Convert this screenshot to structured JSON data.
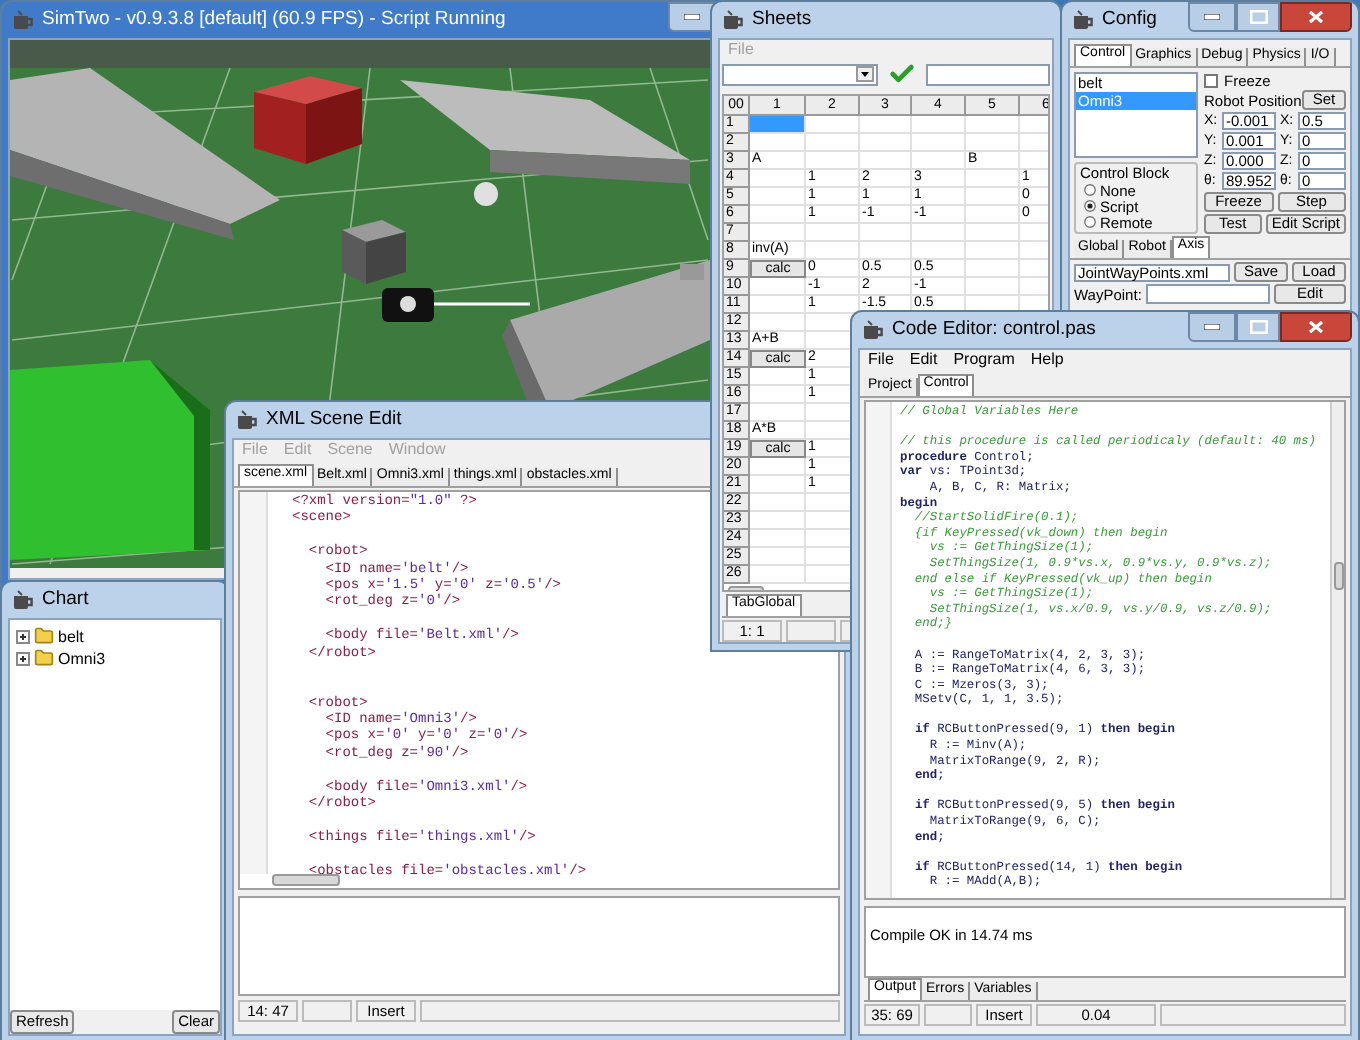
{
  "main_window": {
    "title": "SimTwo - v0.9.3.8 [default] (60.9 FPS) - Script Running"
  },
  "chart_window": {
    "title": "Chart",
    "tree": [
      {
        "label": "belt",
        "expanded": false
      },
      {
        "label": "Omni3",
        "expanded": false
      }
    ],
    "buttons": [
      "Refresh",
      "Clear"
    ]
  },
  "xml_editor": {
    "title": "XML Scene Edit",
    "menu": [
      {
        "label": "File",
        "disabled": true
      },
      {
        "label": "Edit",
        "disabled": true
      },
      {
        "label": "Scene",
        "disabled": true
      },
      {
        "label": "Window",
        "disabled": true
      }
    ],
    "tabs": [
      {
        "label": "scene.xml",
        "selected": true
      },
      {
        "label": "Belt.xml",
        "selected": false
      },
      {
        "label": "Omni3.xml",
        "selected": false
      },
      {
        "label": "things.xml",
        "selected": false
      },
      {
        "label": "obstacles.xml",
        "selected": false
      }
    ],
    "lines": [
      {
        "kind": "code",
        "text": "<?xml version=\"1.0\" ?>"
      },
      {
        "kind": "code",
        "text": "<scene>"
      },
      {
        "kind": "blank"
      },
      {
        "kind": "code",
        "text": "  <robot>"
      },
      {
        "kind": "code",
        "text": "    <ID name='belt'/>"
      },
      {
        "kind": "code",
        "text": "    <pos x='1.5' y='0' z='0.5'/>"
      },
      {
        "kind": "code",
        "text": "    <rot_deg z='0'/>"
      },
      {
        "kind": "blank"
      },
      {
        "kind": "code",
        "text": "    <body file='Belt.xml'/>"
      },
      {
        "kind": "code",
        "text": "  </robot>"
      },
      {
        "kind": "blank"
      },
      {
        "kind": "blank"
      },
      {
        "kind": "code",
        "text": "  <robot>"
      },
      {
        "kind": "code",
        "text": "    <ID name='Omni3'/>"
      },
      {
        "kind": "code",
        "text": "    <pos x='0' y='0' z='0'/>"
      },
      {
        "kind": "code",
        "text": "    <rot_deg z='90'/>"
      },
      {
        "kind": "blank"
      },
      {
        "kind": "code",
        "text": "    <body file='Omni3.xml'/>"
      },
      {
        "kind": "code",
        "text": "  </robot>"
      },
      {
        "kind": "blank"
      },
      {
        "kind": "code",
        "text": "  <things file='things.xml'/>"
      },
      {
        "kind": "blank"
      },
      {
        "kind": "code",
        "text": "  <obstacles file='obstacles.xml'/>"
      }
    ],
    "status": [
      "14: 47",
      "Insert"
    ]
  },
  "sheets": {
    "title": "Sheets",
    "menu": [
      {
        "label": "File",
        "disabled": true
      }
    ],
    "columns": [
      "00",
      "1",
      "2",
      "3",
      "4",
      "5",
      "6"
    ],
    "rows": [
      {
        "num": "1",
        "cells": {
          "col_1": {
            "kind": "empty",
            "selected": true
          }
        }
      },
      {
        "num": "2",
        "cells": {}
      },
      {
        "num": "3",
        "cells": {
          "col_1": {
            "kind": "text",
            "text": "A"
          },
          "col_5": {
            "kind": "text",
            "text": "B"
          }
        }
      },
      {
        "num": "4",
        "cells": {
          "col_2": {
            "kind": "text",
            "text": "1"
          },
          "col_3": {
            "kind": "text",
            "text": "2"
          },
          "col_4": {
            "kind": "text",
            "text": "3"
          },
          "col_6": {
            "kind": "text",
            "text": "1"
          }
        }
      },
      {
        "num": "5",
        "cells": {
          "col_2": {
            "kind": "text",
            "text": "1"
          },
          "col_3": {
            "kind": "text",
            "text": "1"
          },
          "col_4": {
            "kind": "text",
            "text": "1"
          },
          "col_6": {
            "kind": "text",
            "text": "0"
          }
        }
      },
      {
        "num": "6",
        "cells": {
          "col_2": {
            "kind": "text",
            "text": "1"
          },
          "col_3": {
            "kind": "text",
            "text": "-1"
          },
          "col_4": {
            "kind": "text",
            "text": "-1"
          },
          "col_6": {
            "kind": "text",
            "text": "0"
          }
        }
      },
      {
        "num": "7",
        "cells": {}
      },
      {
        "num": "8",
        "cells": {
          "col_1": {
            "kind": "text",
            "text": "inv(A)"
          }
        }
      },
      {
        "num": "9",
        "cells": {
          "col_1": {
            "kind": "button",
            "text": "calc"
          },
          "col_2": {
            "kind": "text",
            "text": "0"
          },
          "col_3": {
            "kind": "text",
            "text": "0.5"
          },
          "col_4": {
            "kind": "text",
            "text": "0.5"
          }
        }
      },
      {
        "num": "10",
        "cells": {
          "col_2": {
            "kind": "text",
            "text": "-1"
          },
          "col_3": {
            "kind": "text",
            "text": "2"
          },
          "col_4": {
            "kind": "text",
            "text": "-1"
          }
        }
      },
      {
        "num": "11",
        "cells": {
          "col_2": {
            "kind": "text",
            "text": "1"
          },
          "col_3": {
            "kind": "text",
            "text": "-1.5"
          },
          "col_4": {
            "kind": "text",
            "text": "0.5"
          }
        }
      },
      {
        "num": "12",
        "cells": {}
      },
      {
        "num": "13",
        "cells": {
          "col_1": {
            "kind": "text",
            "text": "A+B"
          }
        }
      },
      {
        "num": "14",
        "cells": {
          "col_1": {
            "kind": "button",
            "text": "calc"
          },
          "col_2": {
            "kind": "text",
            "text": "2"
          }
        }
      },
      {
        "num": "15",
        "cells": {
          "col_2": {
            "kind": "text",
            "text": "1"
          }
        }
      },
      {
        "num": "16",
        "cells": {
          "col_2": {
            "kind": "text",
            "text": "1"
          }
        }
      },
      {
        "num": "17",
        "cells": {}
      },
      {
        "num": "18",
        "cells": {
          "col_1": {
            "kind": "text",
            "text": "A*B"
          }
        }
      },
      {
        "num": "19",
        "cells": {
          "col_1": {
            "kind": "button",
            "text": "calc"
          },
          "col_2": {
            "kind": "text",
            "text": "1"
          }
        }
      },
      {
        "num": "20",
        "cells": {
          "col_2": {
            "kind": "text",
            "text": "1"
          }
        }
      },
      {
        "num": "21",
        "cells": {
          "col_2": {
            "kind": "text",
            "text": "1"
          }
        }
      },
      {
        "num": "22",
        "cells": {}
      },
      {
        "num": "23",
        "cells": {}
      },
      {
        "num": "24",
        "cells": {}
      },
      {
        "num": "25",
        "cells": {}
      },
      {
        "num": "26",
        "cells": {}
      }
    ],
    "tabs": [
      {
        "label": "TabGlobal",
        "selected": true
      }
    ],
    "status": "1: 1"
  },
  "config": {
    "title": "Config",
    "tabs": [
      {
        "label": "Control",
        "selected": true
      },
      {
        "label": "Graphics",
        "selected": false
      },
      {
        "label": "Debug",
        "selected": false
      },
      {
        "label": "Physics",
        "selected": false
      },
      {
        "label": "I/O",
        "selected": false
      }
    ],
    "robots": [
      {
        "label": "belt",
        "selected": false
      },
      {
        "label": "Omni3",
        "selected": true
      }
    ],
    "freeze": {
      "label": "Freeze",
      "checked": false
    },
    "position_label": "Robot Position",
    "set_button": "Set",
    "position": [
      {
        "label": "X:",
        "value": "-0.001"
      },
      {
        "label": "Y:",
        "value": "0.001"
      },
      {
        "label": "Z:",
        "value": "0.000"
      },
      {
        "label": "θ:",
        "value": "89.952"
      }
    ],
    "target": [
      {
        "label": "X:",
        "value": "0.5"
      },
      {
        "label": "Y:",
        "value": "0"
      },
      {
        "label": "Z:",
        "value": "0"
      },
      {
        "label": "θ:",
        "value": "0"
      }
    ],
    "control_block": {
      "title": "Control Block",
      "options": [
        {
          "label": "None",
          "selected": false
        },
        {
          "label": "Script",
          "selected": true
        },
        {
          "label": "Remote",
          "selected": false
        }
      ]
    },
    "buttons": [
      "Freeze",
      "Step",
      "Test",
      "Edit Script"
    ],
    "lower_tabs": [
      {
        "label": "Global",
        "selected": false
      },
      {
        "label": "Robot",
        "selected": false
      },
      {
        "label": "Axis",
        "selected": true
      }
    ],
    "file_field": "JointWayPoints.xml",
    "file_buttons": [
      "Save",
      "Load"
    ],
    "waypoint_label": "WayPoint:",
    "edit_button": "Edit"
  },
  "code_editor": {
    "title": "Code Editor: control.pas",
    "menu": [
      {
        "label": "File",
        "disabled": false
      },
      {
        "label": "Edit",
        "disabled": false
      },
      {
        "label": "Program",
        "disabled": false
      },
      {
        "label": "Help",
        "disabled": false
      }
    ],
    "tabs": [
      {
        "label": "Project",
        "selected": false
      },
      {
        "label": "Control",
        "selected": true
      }
    ],
    "lines": [
      {
        "kind": "comment",
        "text": "// Global Variables Here"
      },
      {
        "kind": "blank"
      },
      {
        "kind": "comment",
        "text": "// this procedure is called periodicaly (default: 40 ms)"
      },
      {
        "kind": "code",
        "text": "**procedure** Control;"
      },
      {
        "kind": "code",
        "text": "**var** vs: TPoint3d;"
      },
      {
        "kind": "code",
        "text": "    A, B, C, R: Matrix;"
      },
      {
        "kind": "code",
        "text": "**begin**"
      },
      {
        "kind": "comment",
        "text": "  //StartSolidFire(0.1);"
      },
      {
        "kind": "comment",
        "text": "  {if KeyPressed(vk_down) then begin"
      },
      {
        "kind": "comment",
        "text": "    vs := GetThingSize(1);"
      },
      {
        "kind": "comment",
        "text": "    SetThingSize(1, 0.9*vs.x, 0.9*vs.y, 0.9*vs.z);"
      },
      {
        "kind": "comment",
        "text": "  end else if KeyPressed(vk_up) then begin"
      },
      {
        "kind": "comment",
        "text": "    vs := GetThingSize(1);"
      },
      {
        "kind": "comment",
        "text": "    SetThingSize(1, vs.x/0.9, vs.y/0.9, vs.z/0.9);"
      },
      {
        "kind": "comment",
        "text": "  end;}"
      },
      {
        "kind": "blank"
      },
      {
        "kind": "code",
        "text": "  A := RangeToMatrix(4, 2, 3, 3);"
      },
      {
        "kind": "code",
        "text": "  B := RangeToMatrix(4, 6, 3, 3);"
      },
      {
        "kind": "code",
        "text": "  C := Mzeros(3, 3);"
      },
      {
        "kind": "code",
        "text": "  MSetv(C, 1, 1, 3.5);"
      },
      {
        "kind": "blank"
      },
      {
        "kind": "code",
        "text": "  **if** RCButtonPressed(9, 1) **then begin**"
      },
      {
        "kind": "code",
        "text": "    R := Minv(A);"
      },
      {
        "kind": "code",
        "text": "    MatrixToRange(9, 2, R);"
      },
      {
        "kind": "code",
        "text": "  **end**;"
      },
      {
        "kind": "blank"
      },
      {
        "kind": "code",
        "text": "  **if** RCButtonPressed(9, 5) **then begin**"
      },
      {
        "kind": "code",
        "text": "    MatrixToRange(9, 6, C);"
      },
      {
        "kind": "code",
        "text": "  **end**;"
      },
      {
        "kind": "blank"
      },
      {
        "kind": "code",
        "text": "  **if** RCButtonPressed(14, 1) **then begin**"
      },
      {
        "kind": "code",
        "text": "    R := MAdd(A,B);"
      }
    ],
    "output": "Compile OK in 14.74 ms",
    "output_tabs": [
      {
        "label": "Output",
        "selected": true
      },
      {
        "label": "Errors",
        "selected": false
      },
      {
        "label": "Variables",
        "selected": false
      }
    ],
    "status": [
      "35: 69",
      "Insert",
      "0.04"
    ]
  }
}
